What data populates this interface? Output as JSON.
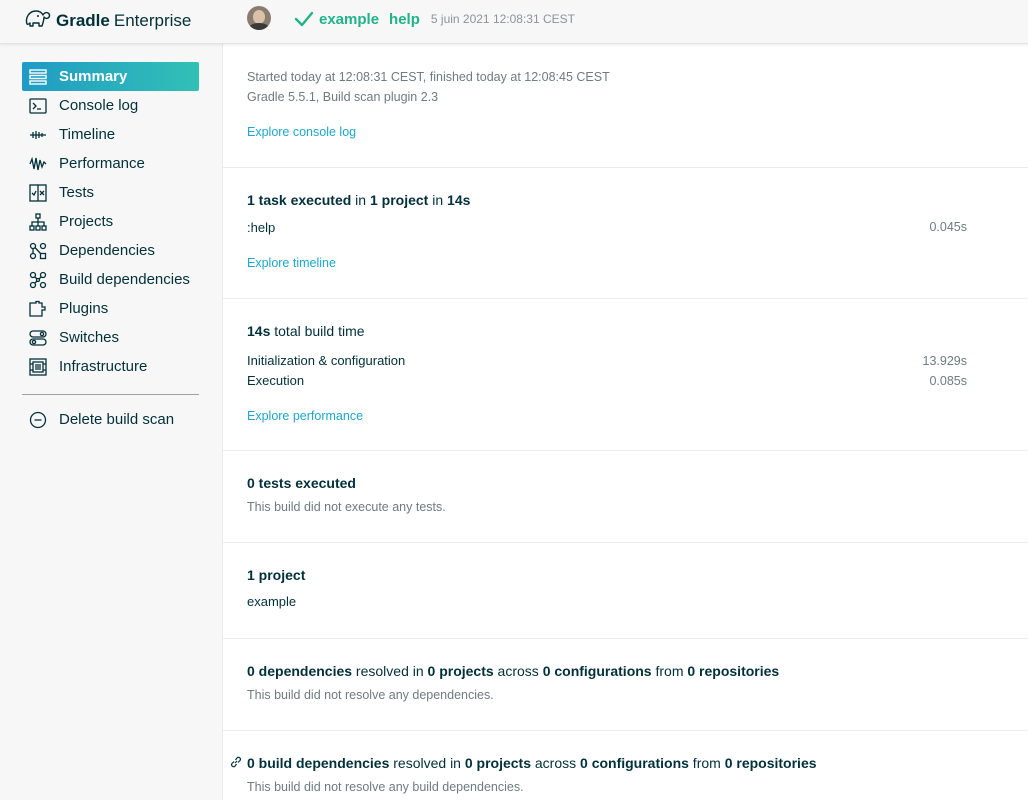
{
  "header": {
    "brand_bold": "Gradle",
    "brand_light": "Enterprise",
    "project": "example",
    "task": "help",
    "timestamp": "5 juin 2021 12:08:31 CEST"
  },
  "sidebar": {
    "items": [
      {
        "label": "Summary",
        "icon": "summary-icon",
        "active": true
      },
      {
        "label": "Console log",
        "icon": "console-icon"
      },
      {
        "label": "Timeline",
        "icon": "timeline-icon"
      },
      {
        "label": "Performance",
        "icon": "performance-icon"
      },
      {
        "label": "Tests",
        "icon": "tests-icon"
      },
      {
        "label": "Projects",
        "icon": "projects-icon"
      },
      {
        "label": "Dependencies",
        "icon": "dependencies-icon"
      },
      {
        "label": "Build dependencies",
        "icon": "build-dependencies-icon"
      },
      {
        "label": "Plugins",
        "icon": "plugins-icon"
      },
      {
        "label": "Switches",
        "icon": "switches-icon"
      },
      {
        "label": "Infrastructure",
        "icon": "infrastructure-icon"
      }
    ],
    "delete_label": "Delete build scan"
  },
  "main": {
    "intro": {
      "started": "Started today at 12:08:31 CEST, finished today at 12:08:45 CEST",
      "versions": "Gradle 5.5.1,  Build scan plugin 2.3",
      "link": "Explore console log"
    },
    "tasks": {
      "t1": "1 task executed",
      "t2": " in ",
      "t3": "1 project",
      "t4": " in ",
      "t5": "14s",
      "row_label": ":help",
      "row_value": "0.045s",
      "link": "Explore timeline"
    },
    "buildtime": {
      "t1": "14s",
      "t2": " total build time",
      "rows": [
        {
          "label": "Initialization & configuration",
          "value": "13.929s"
        },
        {
          "label": "Execution",
          "value": "0.085s"
        }
      ],
      "link": "Explore performance"
    },
    "tests": {
      "title": "0 tests executed",
      "note": "This build did not execute any tests."
    },
    "projects": {
      "title": "1 project",
      "item": "example"
    },
    "deps": {
      "t1": "0 dependencies",
      "t2": " resolved in ",
      "t3": "0 projects",
      "t4": " across ",
      "t5": "0 configurations",
      "t6": " from ",
      "t7": "0 repositories",
      "note": "This build did not resolve any dependencies."
    },
    "builddeps": {
      "t1": "0 build dependencies",
      "t2": " resolved in ",
      "t3": "0 projects",
      "t4": " across ",
      "t5": "0 configurations",
      "t6": " from ",
      "t7": "0 repositories",
      "note": "This build did not resolve any build dependencies."
    }
  },
  "colors": {
    "accent": "#1ba8cb",
    "success": "#20b389",
    "text": "#02303a"
  }
}
